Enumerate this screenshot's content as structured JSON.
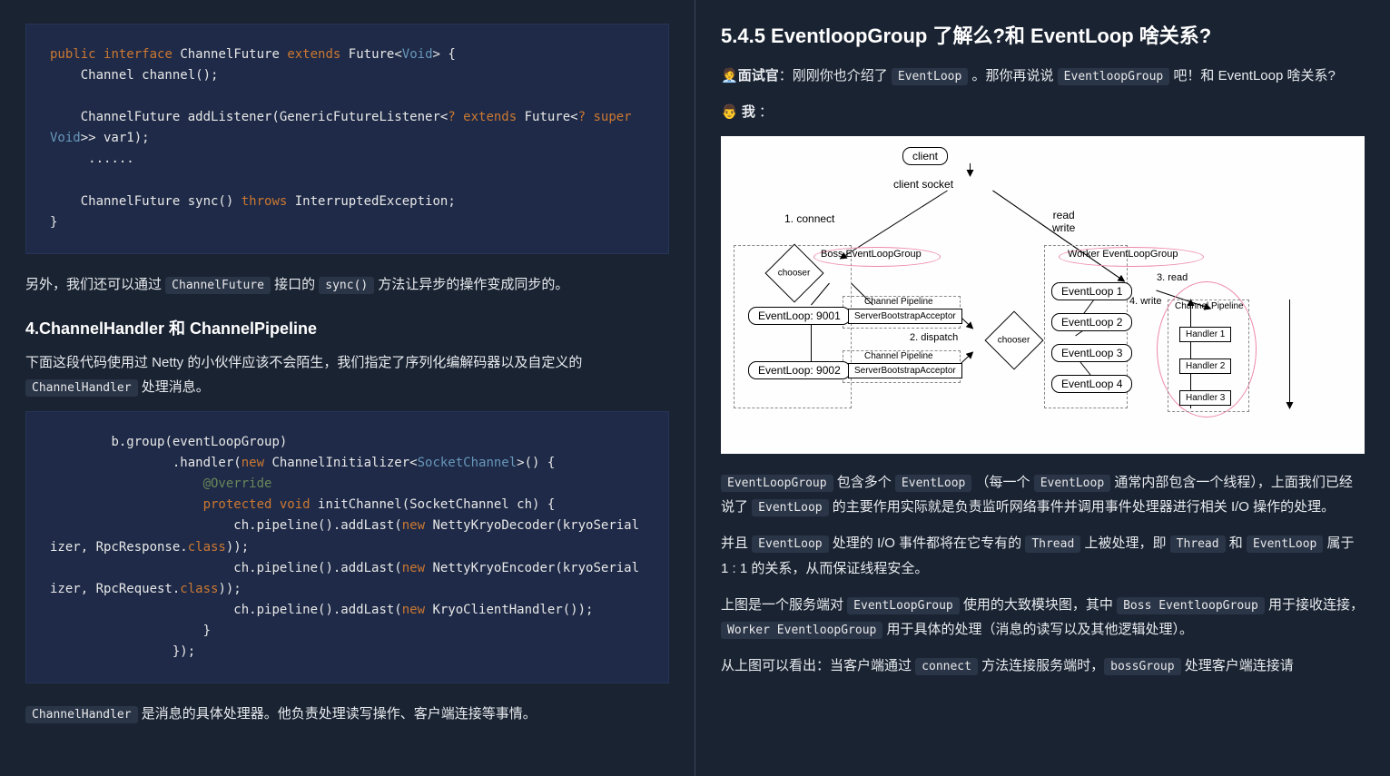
{
  "left": {
    "code1": {
      "l1": [
        "public",
        "interface",
        "ChannelFuture",
        "extends",
        "Future<",
        "Void",
        "> {"
      ],
      "l2": "    Channel channel();",
      "l3": "    ChannelFuture addListener(GenericFutureListener<",
      "l3b": "? extends ",
      "l3c": "Future<",
      "l3d": "? super ",
      "l3e": "Void",
      "l4": ">> var1);",
      "l5": "     ......",
      "l6": "    ChannelFuture sync() ",
      "l6b": "throws",
      "l6c": " InterruptedException;",
      "l7": "}"
    },
    "p1": {
      "a": "另外，我们还可以通过 ",
      "b": "ChannelFuture",
      "c": " 接口的 ",
      "d": "sync()",
      "e": " 方法让异步的操作变成同步的。"
    },
    "h1": "4.ChannelHandler 和 ChannelPipeline",
    "p2": {
      "a": "下面这段代码使用过 Netty 的小伙伴应该不会陌生，我们指定了序列化编解码器以及自定义的",
      "b": "ChannelHandler",
      "c": " 处理消息。"
    },
    "code2": {
      "l1": "        b.group(eventLoopGroup)",
      "l2a": "                .handler(",
      "l2b": "new",
      "l2c": " ChannelInitializer<",
      "l2d": "SocketChannel",
      "l2e": ">() {",
      "l3": "                    @Override",
      "l4a": "                    ",
      "l4b": "protected void",
      "l4c": " initChannel(SocketChannel ch) {",
      "l5a": "                        ch.pipeline().addLast(",
      "l5b": "new",
      "l5c": " NettyKryoDecoder(kryoSerializer, RpcResponse.",
      "l5d": "class",
      "l5e": "));",
      "l6a": "                        ch.pipeline().addLast(",
      "l6b": "new",
      "l6c": " NettyKryoEncoder(kryoSerializer, RpcRequest.",
      "l6d": "class",
      "l6e": "));",
      "l7a": "                        ch.pipeline().addLast(",
      "l7b": "new",
      "l7c": " KryoClientHandler());",
      "l8": "                    }",
      "l9": "                });"
    },
    "p3": {
      "a": "ChannelHandler",
      "b": " 是消息的具体处理器。他负责处理读写操作、客户端连接等事情。"
    }
  },
  "right": {
    "h1": "5.4.5 EventloopGroup 了解么?和 EventLoop 啥关系?",
    "p1": {
      "icon": "🧑‍💼",
      "a": "面试官",
      "b": "：刚刚你也介绍了 ",
      "c": "EventLoop",
      "d": " 。那你再说说 ",
      "e": "EventloopGroup",
      "f": " 吧！和 EventLoop 啥关系?"
    },
    "p2": {
      "icon": "👨",
      "a": " 我 ",
      "b": "："
    },
    "diagram": {
      "nodes": {
        "client": "client",
        "clientsocket": "client socket",
        "bossGroup": "Boss EventLoopGroup",
        "workerGroup": "Worker EventLoopGroup",
        "el9001": "EventLoop: 9001",
        "el9002": "EventLoop: 9002",
        "cp1": "Channel Pipeline",
        "cp2": "Channel Pipeline",
        "cp3": "Channel Pipeline",
        "sba1": "ServerBootstrapAcceptor",
        "sba2": "ServerBootstrapAcceptor",
        "el1": "EventLoop 1",
        "el2": "EventLoop 2",
        "el3": "EventLoop 3",
        "el4": "EventLoop 4",
        "h1": "Handler 1",
        "h2": "Handler 2",
        "h3": "Handler 3",
        "chooser": "chooser"
      },
      "labels": {
        "connect": "1. connect",
        "dispatch": "2. dispatch",
        "read1": "3. read",
        "write": "4. write",
        "readwrite": "read\nwrite"
      }
    },
    "p3": {
      "a": "EventLoopGroup",
      "b": " 包含多个 ",
      "c": "EventLoop",
      "d": " （每一个 ",
      "e": "EventLoop",
      "f": " 通常内部包含一个线程），上面我们已经说了 ",
      "g": "EventLoop",
      "h": " 的主要作用实际就是负责监听网络事件并调用事件处理器进行相关 I/O 操作的处理。"
    },
    "p4": {
      "a": "并且 ",
      "b": "EventLoop",
      "c": " 处理的 I/O 事件都将在它专有的 ",
      "d": "Thread",
      "e": " 上被处理，即 ",
      "f": "Thread",
      "g": " 和 ",
      "h": "EventLoop",
      "i": " 属于 1 : 1 的关系，从而保证线程安全。"
    },
    "p5": {
      "a": "上图是一个服务端对 ",
      "b": "EventLoopGroup",
      "c": " 使用的大致模块图，其中 ",
      "d": "Boss EventloopGroup",
      "e": " 用于接收连接，",
      "f": "Worker EventloopGroup",
      "g": " 用于具体的处理（消息的读写以及其他逻辑处理）。"
    },
    "p6": {
      "a": "从上图可以看出：当客户端通过 ",
      "b": "connect",
      "c": " 方法连接服务端时，",
      "d": "bossGroup",
      "e": " 处理客户端连接请"
    }
  }
}
